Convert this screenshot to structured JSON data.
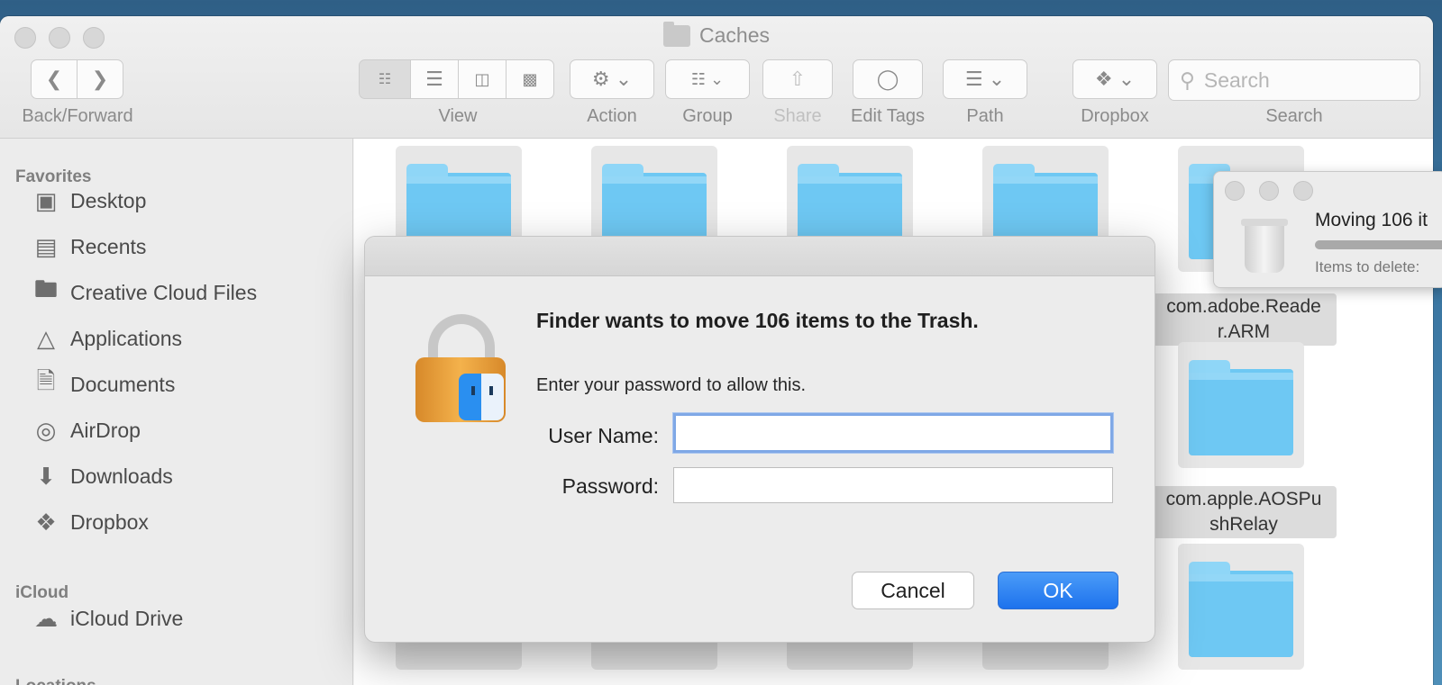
{
  "window": {
    "title": "Caches"
  },
  "toolbar": {
    "back_forward_label": "Back/Forward",
    "view_label": "View",
    "action_label": "Action",
    "group_label": "Group",
    "share_label": "Share",
    "edit_tags_label": "Edit Tags",
    "path_label": "Path",
    "dropbox_label": "Dropbox",
    "search_label": "Search",
    "search_placeholder": "Search"
  },
  "sidebar": {
    "favorites_heading": "Favorites",
    "favorites": [
      {
        "label": "Desktop",
        "icon": "desktop-icon"
      },
      {
        "label": "Recents",
        "icon": "recents-icon"
      },
      {
        "label": "Creative Cloud Files",
        "icon": "folder-icon"
      },
      {
        "label": "Applications",
        "icon": "applications-icon"
      },
      {
        "label": "Documents",
        "icon": "documents-icon"
      },
      {
        "label": "AirDrop",
        "icon": "airdrop-icon"
      },
      {
        "label": "Downloads",
        "icon": "downloads-icon"
      },
      {
        "label": "Dropbox",
        "icon": "dropbox-icon"
      }
    ],
    "icloud_heading": "iCloud",
    "icloud": [
      {
        "label": "iCloud Drive",
        "icon": "cloud-icon"
      }
    ],
    "locations_heading": "Locations"
  },
  "content": {
    "labeled_items": [
      {
        "line1": "com.adobe.Reade",
        "line2": "r.ARM"
      },
      {
        "line1": "com.apple.AOSPu",
        "line2": "shRelay"
      }
    ]
  },
  "progress": {
    "moving_text": "Moving 106 it",
    "items_to_delete": "Items to delete:",
    "fraction": 0.95
  },
  "dialog": {
    "title": "Finder wants to move 106 items to the Trash.",
    "message": "Enter your password to allow this.",
    "username_label": "User Name:",
    "username_value": "",
    "password_label": "Password:",
    "password_value": "",
    "cancel_label": "Cancel",
    "ok_label": "OK"
  },
  "colors": {
    "accent": "#1d72ed",
    "folder": "#6ec8f3",
    "lock": "#f4b24c"
  }
}
